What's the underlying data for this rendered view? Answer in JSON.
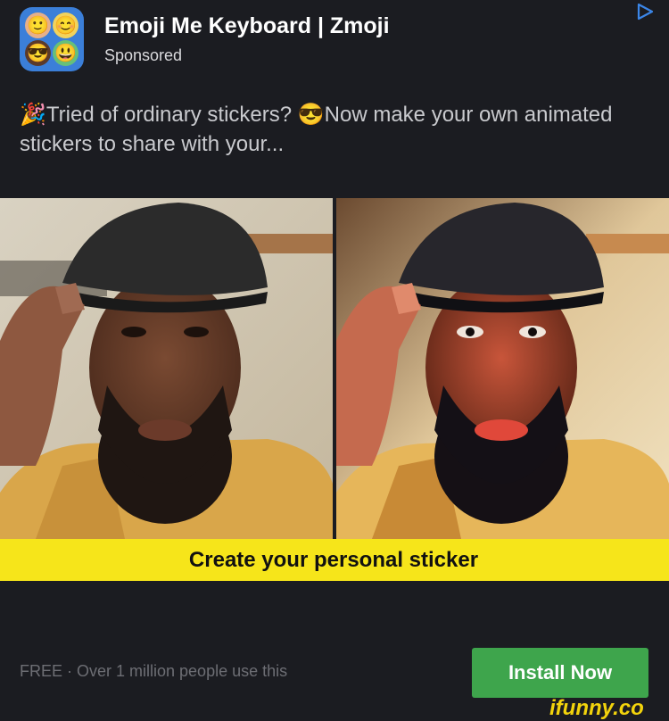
{
  "ad": {
    "app_title": "Emoji Me Keyboard | Zmoji",
    "sponsored": "Sponsored",
    "body_emoji_1": "🎉",
    "body_part_1": "Tried of ordinary stickers? ",
    "body_emoji_2": "😎",
    "body_part_2": "Now make your own animated stickers to share with your...",
    "banner": "Create your personal sticker",
    "footer": "FREE · Over 1 million people use this",
    "install_button": "Install Now",
    "adchoices_icon": "play-triangle-icon"
  },
  "watermark": "ifunny.co",
  "colors": {
    "background": "#1b1c21",
    "banner": "#f6e51a",
    "install_button": "#3ea54c",
    "adchoices": "#3b86e8",
    "watermark": "#f2d30c"
  }
}
